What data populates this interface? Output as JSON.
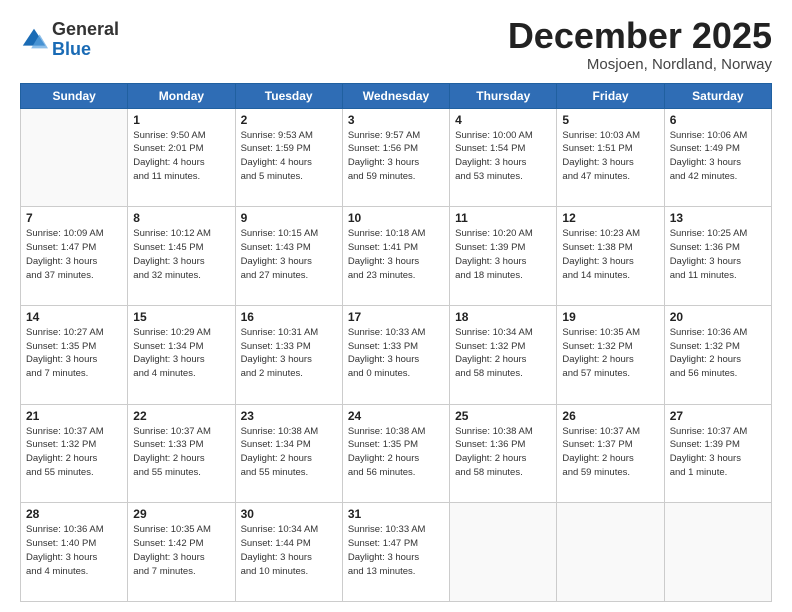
{
  "logo": {
    "general": "General",
    "blue": "Blue"
  },
  "header": {
    "month": "December 2025",
    "location": "Mosjoen, Nordland, Norway"
  },
  "weekdays": [
    "Sunday",
    "Monday",
    "Tuesday",
    "Wednesday",
    "Thursday",
    "Friday",
    "Saturday"
  ],
  "weeks": [
    [
      {
        "day": "",
        "info": ""
      },
      {
        "day": "1",
        "info": "Sunrise: 9:50 AM\nSunset: 2:01 PM\nDaylight: 4 hours\nand 11 minutes."
      },
      {
        "day": "2",
        "info": "Sunrise: 9:53 AM\nSunset: 1:59 PM\nDaylight: 4 hours\nand 5 minutes."
      },
      {
        "day": "3",
        "info": "Sunrise: 9:57 AM\nSunset: 1:56 PM\nDaylight: 3 hours\nand 59 minutes."
      },
      {
        "day": "4",
        "info": "Sunrise: 10:00 AM\nSunset: 1:54 PM\nDaylight: 3 hours\nand 53 minutes."
      },
      {
        "day": "5",
        "info": "Sunrise: 10:03 AM\nSunset: 1:51 PM\nDaylight: 3 hours\nand 47 minutes."
      },
      {
        "day": "6",
        "info": "Sunrise: 10:06 AM\nSunset: 1:49 PM\nDaylight: 3 hours\nand 42 minutes."
      }
    ],
    [
      {
        "day": "7",
        "info": "Sunrise: 10:09 AM\nSunset: 1:47 PM\nDaylight: 3 hours\nand 37 minutes."
      },
      {
        "day": "8",
        "info": "Sunrise: 10:12 AM\nSunset: 1:45 PM\nDaylight: 3 hours\nand 32 minutes."
      },
      {
        "day": "9",
        "info": "Sunrise: 10:15 AM\nSunset: 1:43 PM\nDaylight: 3 hours\nand 27 minutes."
      },
      {
        "day": "10",
        "info": "Sunrise: 10:18 AM\nSunset: 1:41 PM\nDaylight: 3 hours\nand 23 minutes."
      },
      {
        "day": "11",
        "info": "Sunrise: 10:20 AM\nSunset: 1:39 PM\nDaylight: 3 hours\nand 18 minutes."
      },
      {
        "day": "12",
        "info": "Sunrise: 10:23 AM\nSunset: 1:38 PM\nDaylight: 3 hours\nand 14 minutes."
      },
      {
        "day": "13",
        "info": "Sunrise: 10:25 AM\nSunset: 1:36 PM\nDaylight: 3 hours\nand 11 minutes."
      }
    ],
    [
      {
        "day": "14",
        "info": "Sunrise: 10:27 AM\nSunset: 1:35 PM\nDaylight: 3 hours\nand 7 minutes."
      },
      {
        "day": "15",
        "info": "Sunrise: 10:29 AM\nSunset: 1:34 PM\nDaylight: 3 hours\nand 4 minutes."
      },
      {
        "day": "16",
        "info": "Sunrise: 10:31 AM\nSunset: 1:33 PM\nDaylight: 3 hours\nand 2 minutes."
      },
      {
        "day": "17",
        "info": "Sunrise: 10:33 AM\nSunset: 1:33 PM\nDaylight: 3 hours\nand 0 minutes."
      },
      {
        "day": "18",
        "info": "Sunrise: 10:34 AM\nSunset: 1:32 PM\nDaylight: 2 hours\nand 58 minutes."
      },
      {
        "day": "19",
        "info": "Sunrise: 10:35 AM\nSunset: 1:32 PM\nDaylight: 2 hours\nand 57 minutes."
      },
      {
        "day": "20",
        "info": "Sunrise: 10:36 AM\nSunset: 1:32 PM\nDaylight: 2 hours\nand 56 minutes."
      }
    ],
    [
      {
        "day": "21",
        "info": "Sunrise: 10:37 AM\nSunset: 1:32 PM\nDaylight: 2 hours\nand 55 minutes."
      },
      {
        "day": "22",
        "info": "Sunrise: 10:37 AM\nSunset: 1:33 PM\nDaylight: 2 hours\nand 55 minutes."
      },
      {
        "day": "23",
        "info": "Sunrise: 10:38 AM\nSunset: 1:34 PM\nDaylight: 2 hours\nand 55 minutes."
      },
      {
        "day": "24",
        "info": "Sunrise: 10:38 AM\nSunset: 1:35 PM\nDaylight: 2 hours\nand 56 minutes."
      },
      {
        "day": "25",
        "info": "Sunrise: 10:38 AM\nSunset: 1:36 PM\nDaylight: 2 hours\nand 58 minutes."
      },
      {
        "day": "26",
        "info": "Sunrise: 10:37 AM\nSunset: 1:37 PM\nDaylight: 2 hours\nand 59 minutes."
      },
      {
        "day": "27",
        "info": "Sunrise: 10:37 AM\nSunset: 1:39 PM\nDaylight: 3 hours\nand 1 minute."
      }
    ],
    [
      {
        "day": "28",
        "info": "Sunrise: 10:36 AM\nSunset: 1:40 PM\nDaylight: 3 hours\nand 4 minutes."
      },
      {
        "day": "29",
        "info": "Sunrise: 10:35 AM\nSunset: 1:42 PM\nDaylight: 3 hours\nand 7 minutes."
      },
      {
        "day": "30",
        "info": "Sunrise: 10:34 AM\nSunset: 1:44 PM\nDaylight: 3 hours\nand 10 minutes."
      },
      {
        "day": "31",
        "info": "Sunrise: 10:33 AM\nSunset: 1:47 PM\nDaylight: 3 hours\nand 13 minutes."
      },
      {
        "day": "",
        "info": ""
      },
      {
        "day": "",
        "info": ""
      },
      {
        "day": "",
        "info": ""
      }
    ]
  ]
}
